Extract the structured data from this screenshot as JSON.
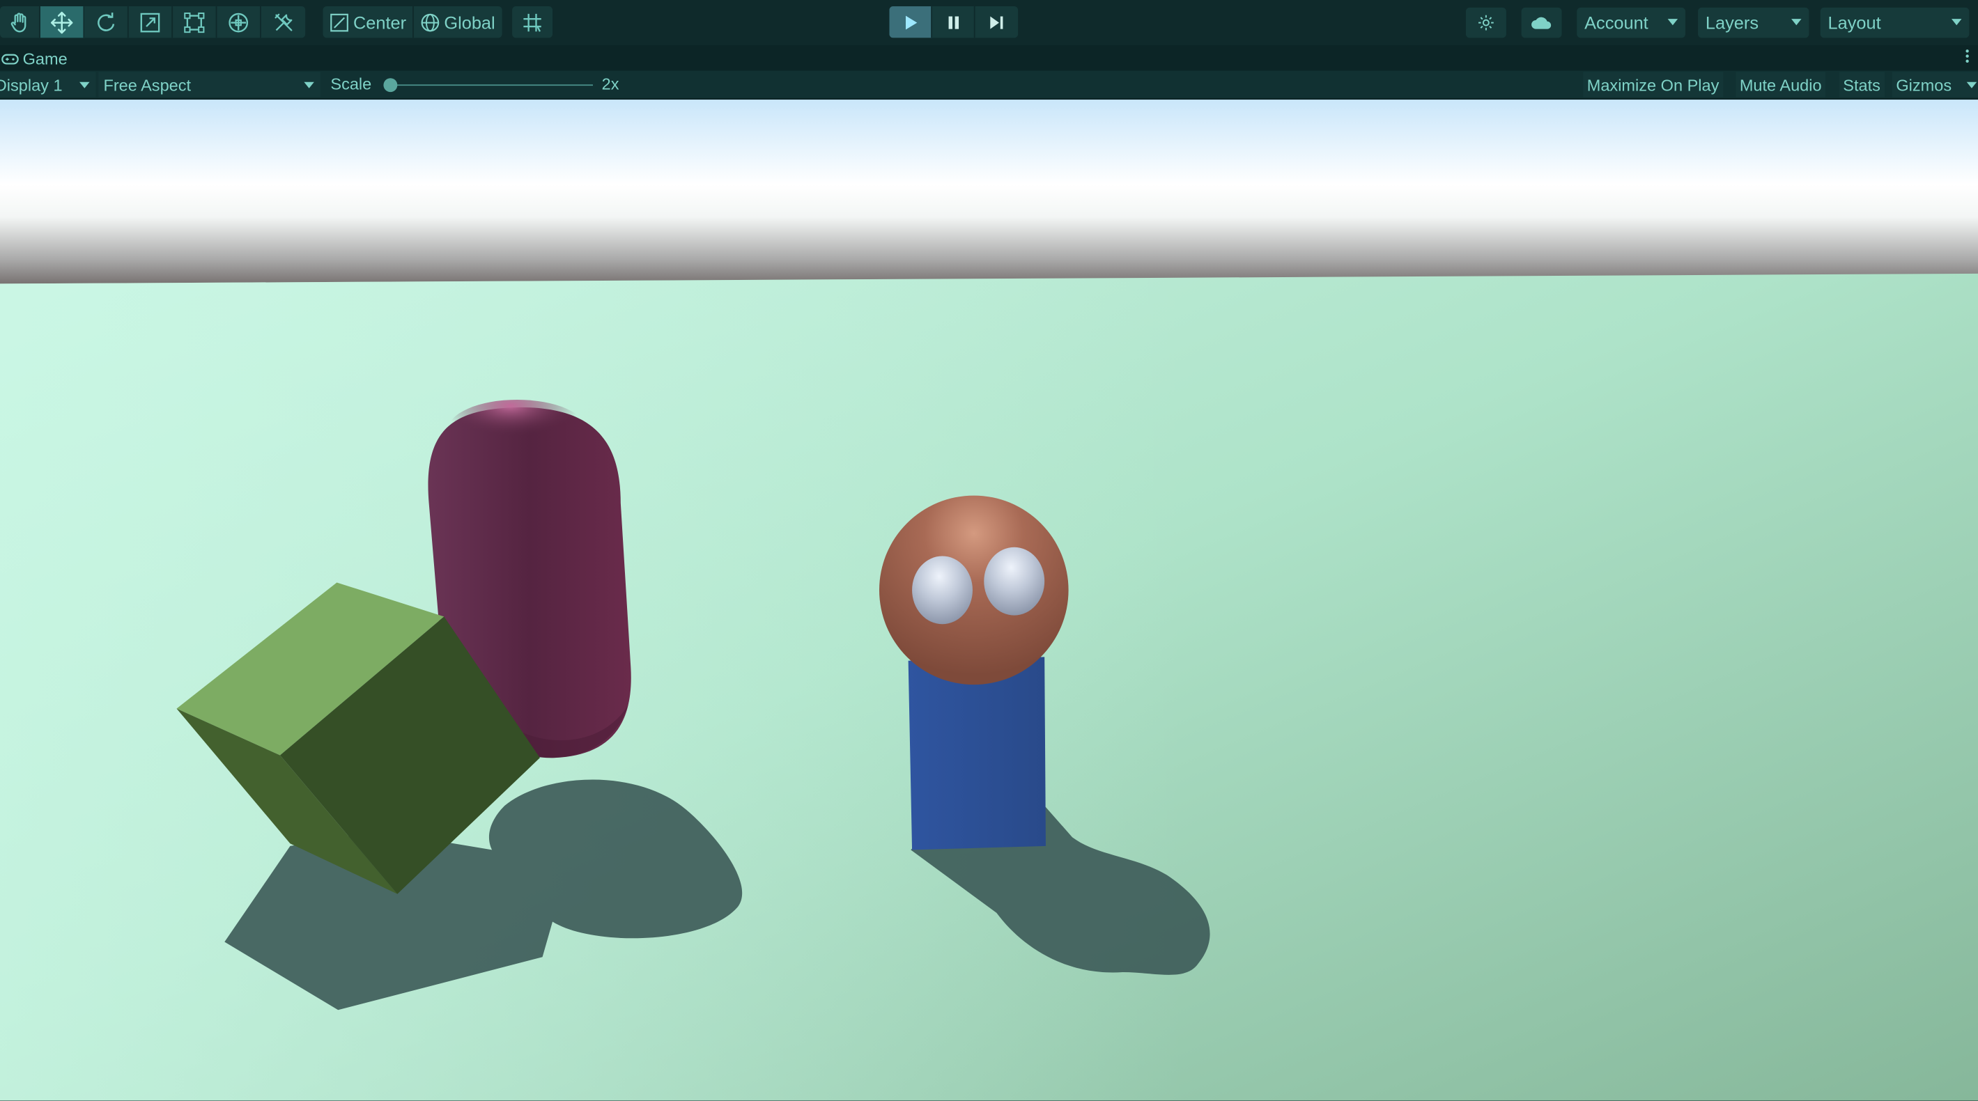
{
  "toolbar": {
    "tools": [
      "hand-tool",
      "move-tool",
      "rotate-tool",
      "scale-tool",
      "rect-tool",
      "transform-tool",
      "custom-tool"
    ],
    "active_tool": "move-tool",
    "pivot_mode": "Center",
    "pivot_rotation": "Global",
    "account_label": "Account",
    "layers_label": "Layers",
    "layout_label": "Layout"
  },
  "game_tab": {
    "title": "Game"
  },
  "game_controls": {
    "display": "Display 1",
    "aspect": "Free Aspect",
    "scale_label": "Scale",
    "scale_value": "2x",
    "maximize_on_play": "Maximize On Play",
    "mute_audio": "Mute Audio",
    "stats": "Stats",
    "gizmos": "Gizmos"
  },
  "colors": {
    "toolbar_bg": "#0f2a2b",
    "accent_text": "#7fd2c7",
    "ground": "#b3e8cf",
    "cube": "#3a5a2a",
    "capsule": "#5c2a47",
    "body": "#2d4e8f",
    "head": "#a86a55"
  }
}
